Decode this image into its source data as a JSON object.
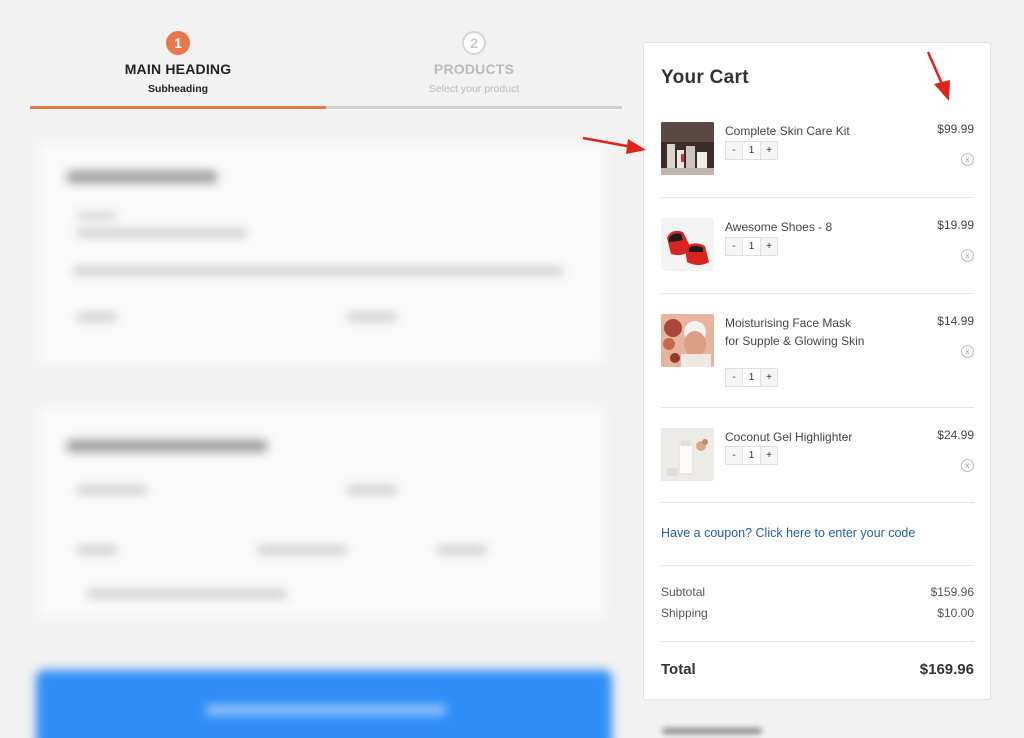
{
  "steps": [
    {
      "number": "1",
      "title": "MAIN HEADING",
      "subtitle": "Subheading",
      "active": true
    },
    {
      "number": "2",
      "title": "PRODUCTS",
      "subtitle": "Select your product",
      "active": false
    }
  ],
  "progress_fraction": 0.5,
  "cart": {
    "title": "Your Cart",
    "items": [
      {
        "name": "Complete Skin Care Kit",
        "price": "$99.99",
        "quantity": "1",
        "minus": "-",
        "plus": "+",
        "remove": "x",
        "icon": "skin-care-kit-image"
      },
      {
        "name": "Awesome Shoes - 8",
        "price": "$19.99",
        "quantity": "1",
        "minus": "-",
        "plus": "+",
        "remove": "x",
        "icon": "shoes-image"
      },
      {
        "name": "Moisturising Face Mask for Supple & Glowing Skin",
        "price": "$14.99",
        "quantity": "1",
        "minus": "-",
        "plus": "+",
        "remove": "x",
        "icon": "face-mask-image"
      },
      {
        "name": "Coconut Gel Highlighter",
        "price": "$24.99",
        "quantity": "1",
        "minus": "-",
        "plus": "+",
        "remove": "x",
        "icon": "highlighter-image"
      }
    ],
    "coupon_link": "Have a coupon? Click here to enter your code",
    "subtotal_label": "Subtotal",
    "subtotal_value": "$159.96",
    "shipping_label": "Shipping",
    "shipping_value": "$10.00",
    "total_label": "Total",
    "total_value": "$169.96"
  },
  "colors": {
    "accent": "#e8774a",
    "link": "#1f5f9e",
    "button": "#2f8ef6",
    "arrow": "#e0231b"
  }
}
